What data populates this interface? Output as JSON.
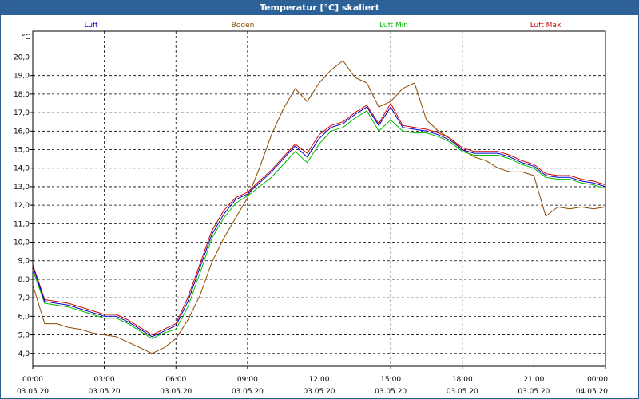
{
  "window": {
    "title": "Temperatur [°C] skaliert"
  },
  "chart_data": {
    "type": "line",
    "title": "Temperatur [°C] skaliert",
    "yunit": "°C",
    "ylim": [
      3.3,
      21.4
    ],
    "yticks": [
      4,
      5,
      6,
      7,
      8,
      9,
      10,
      11,
      12,
      13,
      14,
      15,
      16,
      17,
      18,
      19,
      20
    ],
    "ytick_labels": [
      "4,0",
      "5,0",
      "6,0",
      "7,0",
      "8,0",
      "9,0",
      "10,0",
      "11,0",
      "12,0",
      "13,0",
      "14,0",
      "15,0",
      "16,0",
      "17,0",
      "18,0",
      "19,0",
      "20,0"
    ],
    "xlim": [
      0,
      24
    ],
    "xticks": [
      0,
      3,
      6,
      9,
      12,
      15,
      18,
      21,
      24
    ],
    "xtick_time": [
      "00:00",
      "03:00",
      "06:00",
      "09:00",
      "12:00",
      "15:00",
      "18:00",
      "21:00",
      "00:00"
    ],
    "xtick_date": [
      "03.05.20",
      "03.05.20",
      "03.05.20",
      "03.05.20",
      "03.05.20",
      "03.05.20",
      "03.05.20",
      "03.05.20",
      "04.05.20"
    ],
    "grid": true,
    "legend_position": "top",
    "x": [
      0,
      0.5,
      1,
      1.5,
      2,
      2.5,
      3,
      3.5,
      4,
      4.5,
      5,
      5.5,
      6,
      6.5,
      7,
      7.5,
      8,
      8.5,
      9,
      9.5,
      10,
      10.5,
      11,
      11.5,
      12,
      12.5,
      13,
      13.5,
      14,
      14.5,
      15,
      15.5,
      16,
      16.5,
      17,
      17.5,
      18,
      18.5,
      19,
      19.5,
      20,
      20.5,
      21,
      21.5,
      22,
      22.5,
      23,
      23.5,
      24
    ],
    "series": [
      {
        "name": "Luft",
        "color": "#0000cc",
        "values": [
          8.7,
          6.8,
          6.7,
          6.6,
          6.4,
          6.2,
          6.0,
          6.0,
          5.7,
          5.3,
          4.9,
          5.2,
          5.5,
          6.8,
          8.6,
          10.4,
          11.5,
          12.3,
          12.6,
          13.2,
          13.8,
          14.5,
          15.2,
          14.6,
          15.6,
          16.2,
          16.4,
          16.9,
          17.3,
          16.3,
          17.3,
          16.2,
          16.1,
          16.0,
          15.8,
          15.5,
          15.0,
          14.8,
          14.8,
          14.8,
          14.6,
          14.3,
          14.1,
          13.6,
          13.5,
          13.5,
          13.3,
          13.2,
          13.0
        ]
      },
      {
        "name": "Boden",
        "color": "#8b4a00",
        "values": [
          7.7,
          5.6,
          5.6,
          5.4,
          5.3,
          5.1,
          5.0,
          4.9,
          4.6,
          4.3,
          4.0,
          4.3,
          4.8,
          5.8,
          7.1,
          8.9,
          10.2,
          11.3,
          12.4,
          14.0,
          15.8,
          17.2,
          18.3,
          17.6,
          18.6,
          19.3,
          19.8,
          18.9,
          18.6,
          17.3,
          17.6,
          18.3,
          18.6,
          16.6,
          16.0,
          15.6,
          15.0,
          14.6,
          14.4,
          14.0,
          13.8,
          13.8,
          13.6,
          11.4,
          11.9,
          11.8,
          11.9,
          11.8,
          11.9
        ]
      },
      {
        "name": "Luft Min",
        "color": "#00bb00",
        "values": [
          8.5,
          6.7,
          6.6,
          6.5,
          6.3,
          6.1,
          5.9,
          5.9,
          5.6,
          5.2,
          4.8,
          5.1,
          5.3,
          6.5,
          8.3,
          10.2,
          11.3,
          12.1,
          12.5,
          13.0,
          13.5,
          14.2,
          14.9,
          14.3,
          15.3,
          16.0,
          16.2,
          16.7,
          17.1,
          16.0,
          16.6,
          16.0,
          15.9,
          15.9,
          15.7,
          15.4,
          14.9,
          14.7,
          14.7,
          14.7,
          14.5,
          14.2,
          14.0,
          13.5,
          13.4,
          13.4,
          13.2,
          13.1,
          12.9
        ]
      },
      {
        "name": "Luft Max",
        "color": "#cc0000",
        "values": [
          8.8,
          6.9,
          6.8,
          6.7,
          6.5,
          6.3,
          6.1,
          6.1,
          5.8,
          5.4,
          5.0,
          5.3,
          5.6,
          7.0,
          8.8,
          10.6,
          11.7,
          12.4,
          12.7,
          13.3,
          13.9,
          14.6,
          15.3,
          14.8,
          15.8,
          16.3,
          16.5,
          17.0,
          17.4,
          16.4,
          17.5,
          16.3,
          16.2,
          16.1,
          15.9,
          15.6,
          15.1,
          14.9,
          14.9,
          14.9,
          14.7,
          14.4,
          14.2,
          13.7,
          13.6,
          13.6,
          13.4,
          13.3,
          13.1
        ]
      }
    ]
  }
}
